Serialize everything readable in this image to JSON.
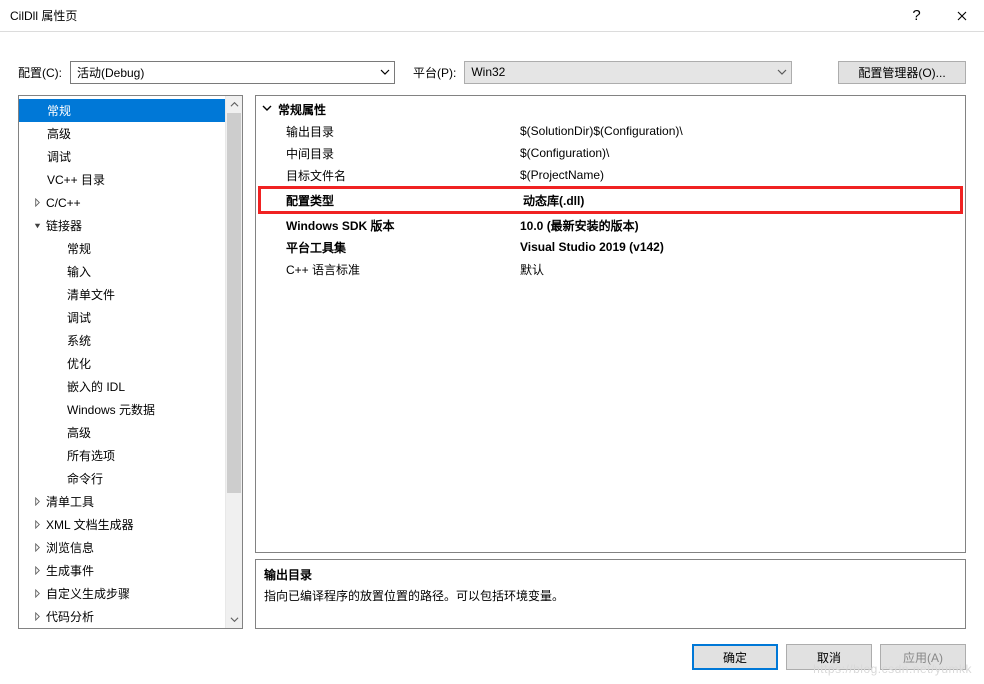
{
  "title": "CilDll 属性页",
  "toolbar": {
    "config_label": "配置(C):",
    "config_value": "活动(Debug)",
    "platform_label": "平台(P):",
    "platform_value": "Win32",
    "manager_label": "配置管理器(O)..."
  },
  "tree": [
    {
      "label": "常规",
      "indent": "ind1",
      "selected": true
    },
    {
      "label": "高级",
      "indent": "ind1"
    },
    {
      "label": "调试",
      "indent": "ind1"
    },
    {
      "label": "VC++ 目录",
      "indent": "ind1"
    },
    {
      "label": "C/C++",
      "indent": "ind1b",
      "expander": "closed"
    },
    {
      "label": "链接器",
      "indent": "ind1b",
      "expander": "open"
    },
    {
      "label": "常规",
      "indent": "ind2"
    },
    {
      "label": "输入",
      "indent": "ind2"
    },
    {
      "label": "清单文件",
      "indent": "ind2"
    },
    {
      "label": "调试",
      "indent": "ind2"
    },
    {
      "label": "系统",
      "indent": "ind2"
    },
    {
      "label": "优化",
      "indent": "ind2"
    },
    {
      "label": "嵌入的 IDL",
      "indent": "ind2"
    },
    {
      "label": "Windows 元数据",
      "indent": "ind2"
    },
    {
      "label": "高级",
      "indent": "ind2"
    },
    {
      "label": "所有选项",
      "indent": "ind2"
    },
    {
      "label": "命令行",
      "indent": "ind2"
    },
    {
      "label": "清单工具",
      "indent": "ind1b",
      "expander": "closed"
    },
    {
      "label": "XML 文档生成器",
      "indent": "ind1b",
      "expander": "closed"
    },
    {
      "label": "浏览信息",
      "indent": "ind1b",
      "expander": "closed"
    },
    {
      "label": "生成事件",
      "indent": "ind1b",
      "expander": "closed"
    },
    {
      "label": "自定义生成步骤",
      "indent": "ind1b",
      "expander": "closed"
    },
    {
      "label": "代码分析",
      "indent": "ind1b",
      "expander": "closed"
    }
  ],
  "props": {
    "group": "常规属性",
    "rows": [
      {
        "k": "输出目录",
        "v": "$(SolutionDir)$(Configuration)\\"
      },
      {
        "k": "中间目录",
        "v": "$(Configuration)\\"
      },
      {
        "k": "目标文件名",
        "v": "$(ProjectName)"
      },
      {
        "k": "配置类型",
        "v": "动态库(.dll)",
        "highlight": true,
        "bold": true
      },
      {
        "k": "Windows SDK 版本",
        "v": "10.0 (最新安装的版本)",
        "bold": true
      },
      {
        "k": "平台工具集",
        "v": "Visual Studio 2019 (v142)",
        "bold": true
      },
      {
        "k": "C++ 语言标准",
        "v": "默认"
      }
    ]
  },
  "desc": {
    "title": "输出目录",
    "body": "指向已编译程序的放置位置的路径。可以包括环境变量。"
  },
  "footer": {
    "ok": "确定",
    "cancel": "取消",
    "apply": "应用(A)"
  },
  "watermark": "https://blog.csdn.net/yumkk"
}
